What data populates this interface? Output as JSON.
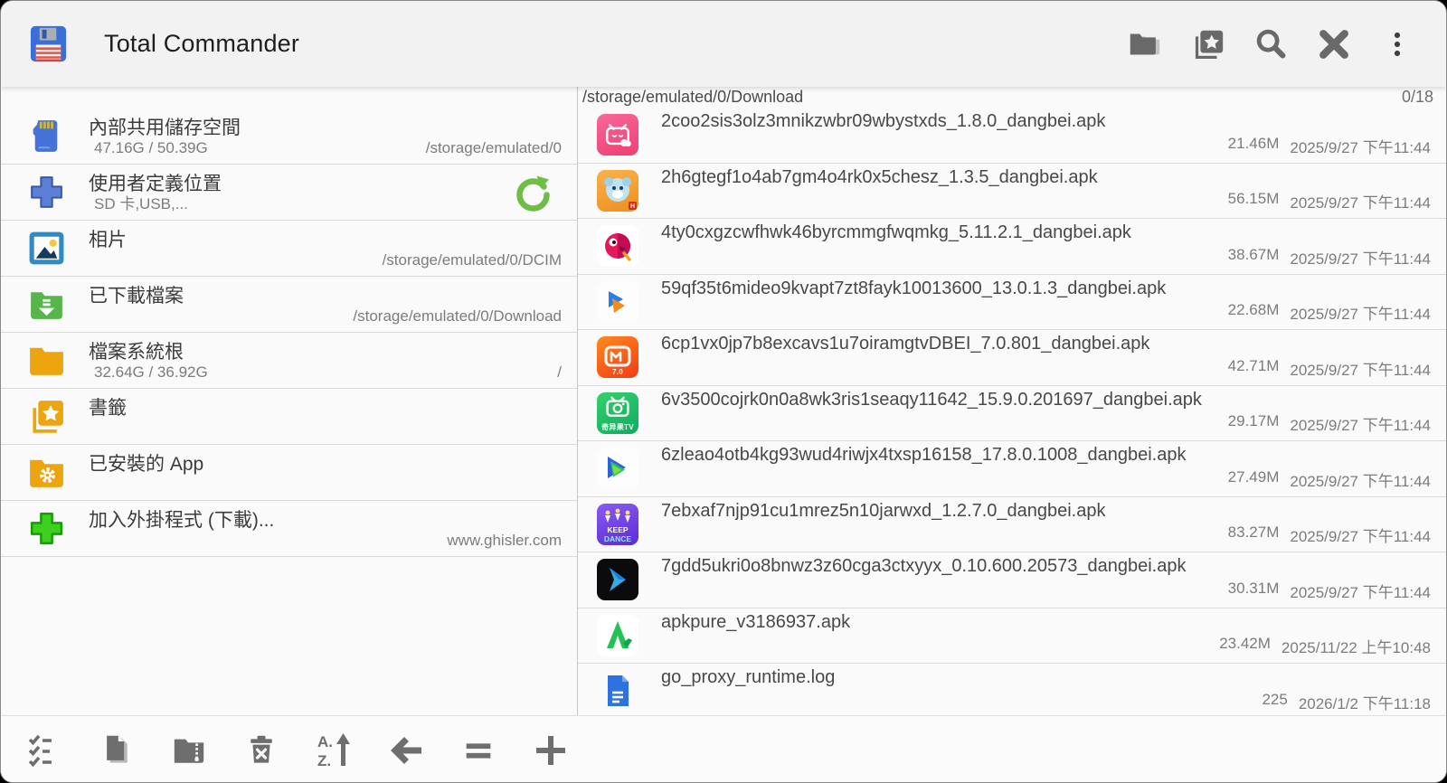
{
  "titlebar": {
    "title": "Total Commander",
    "icons": [
      "folders-icon",
      "bookmarks-icon",
      "search-icon",
      "close-icon",
      "overflow-menu-icon"
    ]
  },
  "left_panel": {
    "items": [
      {
        "icon": "sd-card",
        "label": "內部共用儲存空間",
        "sub": "47.16G / 50.39G",
        "path": "/storage/emulated/0"
      },
      {
        "icon": "add-location",
        "label": "使用者定義位置",
        "sub": "SD 卡,USB,...",
        "path": "",
        "trailing_icon": "refresh"
      },
      {
        "icon": "photos",
        "label": "相片",
        "sub": "",
        "path": "/storage/emulated/0/DCIM"
      },
      {
        "icon": "downloads",
        "label": "已下載檔案",
        "sub": "",
        "path": "/storage/emulated/0/Download"
      },
      {
        "icon": "root-folder",
        "label": "檔案系統根",
        "sub": "32.64G / 36.92G",
        "path": "/"
      },
      {
        "icon": "bookmarks",
        "label": "書籤",
        "sub": "",
        "path": ""
      },
      {
        "icon": "installed-apps",
        "label": "已安裝的 App",
        "sub": "",
        "path": ""
      },
      {
        "icon": "add-plugins",
        "label": "加入外掛程式 (下載)...",
        "sub": "",
        "path": "www.ghisler.com"
      }
    ]
  },
  "right_panel": {
    "path": "/storage/emulated/0/Download",
    "counter": "0/18",
    "files": [
      {
        "icon": "bilibili-tv-app",
        "name": "2coo2sis3olz3mnikzwbr09wbystxds_1.8.0_dangbei.apk",
        "size": "21.46M",
        "date": "2025/9/27 下午11:44"
      },
      {
        "icon": "tiger-game-app",
        "name": "2h6gtegf1o4ab7gm4o4rk0x5chesz_1.3.5_dangbei.apk",
        "size": "56.15M",
        "date": "2025/9/27 下午11:44"
      },
      {
        "icon": "pink-bird-app",
        "name": "4ty0cxgzcwfhwk46byrcmmgfwqmkg_5.11.2.1_dangbei.apk",
        "size": "38.67M",
        "date": "2025/9/27 下午11:44"
      },
      {
        "icon": "video-play-app",
        "name": "59qf35t6mideo9kvapt7zt8fayk10013600_13.0.1.3_dangbei.apk",
        "size": "22.68M",
        "date": "2025/9/27 下午11:44"
      },
      {
        "icon": "mgtv-app",
        "name": "6cp1vx0jp7b8excavs1u7oiramgtvDBEI_7.0.801_dangbei.apk",
        "size": "42.71M",
        "date": "2025/9/27 下午11:44"
      },
      {
        "icon": "qiyiguo-tv-app",
        "name": "6v3500cojrk0n0a8wk3ris1seaqy11642_15.9.0.201697_dangbei.apk",
        "size": "29.17M",
        "date": "2025/9/27 下午11:44"
      },
      {
        "icon": "play-triangle-app",
        "name": "6zleao4otb4kg93wud4riwjx4txsp16158_17.8.0.1008_dangbei.apk",
        "size": "27.49M",
        "date": "2025/9/27 下午11:44"
      },
      {
        "icon": "keep-dance-app",
        "name": "7ebxaf7njp91cu1mrez5n10jarwxd_1.2.7.0_dangbei.apk",
        "size": "83.27M",
        "date": "2025/9/27 下午11:44"
      },
      {
        "icon": "dark-arrow-app",
        "name": "7gdd5ukri0o8bnwz3z60cga3ctxyyx_0.10.600.20573_dangbei.apk",
        "size": "30.31M",
        "date": "2025/9/27 下午11:44"
      },
      {
        "icon": "apkpure-app",
        "name": "apkpure_v3186937.apk",
        "size": "23.42M",
        "date": "2025/11/22 上午10:48"
      },
      {
        "icon": "log-document",
        "name": "go_proxy_runtime.log",
        "size": "225",
        "date": "2026/1/2 下午11:18"
      }
    ],
    "icon_badges": {
      "mgtv": "7.0",
      "qiyiguo": "奇异果TV",
      "dance1": "KEEP",
      "dance2": "DANCE"
    }
  },
  "toolbar": {
    "icons": [
      "select-list-icon",
      "new-file-icon",
      "archive-folder-icon",
      "delete-icon",
      "sort-az-icon",
      "back-arrow-icon",
      "equals-icon",
      "add-icon"
    ]
  },
  "colors": {
    "titlebar_bg": "#f2f2f3",
    "panel_bg": "#fafafa",
    "accent_green": "#6cbf44",
    "folder_amber": "#eca50f",
    "storage_blue": "#4472d8"
  }
}
